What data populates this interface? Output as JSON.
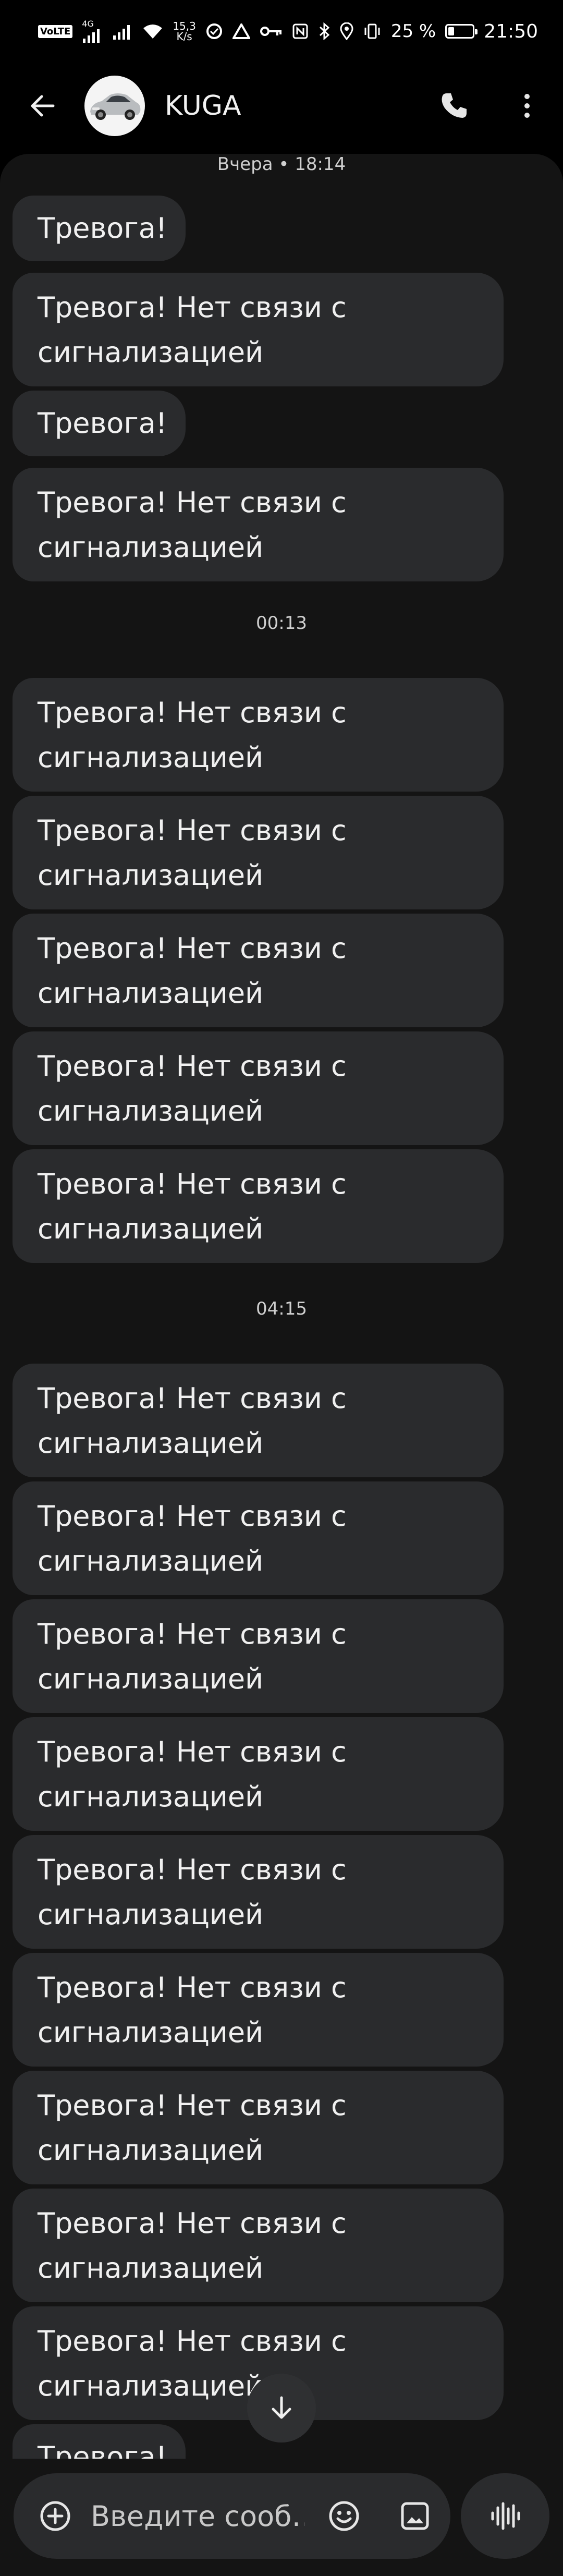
{
  "status_bar": {
    "network_badge": "VoLTE",
    "network_gen": "4G",
    "speed_value": "15,3",
    "speed_unit": "K/s",
    "battery_text": "25 %",
    "battery_level": 0.25,
    "time": "21:50",
    "icons": [
      "volte-icon",
      "signal-icon",
      "signal-icon",
      "wifi-icon",
      "data-saver-icon",
      "mobile-data-icon",
      "vpn-key-icon",
      "nfc-icon",
      "bluetooth-icon",
      "location-icon",
      "vibrate-icon",
      "battery-icon"
    ]
  },
  "header": {
    "contact_name": "KUGA",
    "icons": [
      "back-arrow-icon",
      "car-avatar",
      "phone-icon",
      "more-vert-icon"
    ]
  },
  "conversation": {
    "groups": [
      {
        "time": "Вчера • 18:14",
        "messages": [
          "Тревога!",
          "Тревога! Нет связи с\nсигнализацией",
          "Тревога!",
          "Тревога! Нет связи с\nсигнализацией"
        ]
      },
      {
        "time": "00:13",
        "messages": [
          "Тревога! Нет связи с\nсигнализацией",
          "Тревога! Нет связи с\nсигнализацией",
          "Тревога! Нет связи с\nсигнализацией",
          "Тревога! Нет связи с\nсигнализацией",
          "Тревога! Нет связи с\nсигнализацией"
        ]
      },
      {
        "time": "04:15",
        "messages": [
          "Тревога! Нет связи с\nсигнализацией",
          "Тревога! Нет связи с\nсигнализацией",
          "Тревога! Нет связи с\nсигнализацией",
          "Тревога! Нет связи с\nсигнализацией",
          "Тревога! Нет связи с\nсигнализацией",
          "Тревога! Нет связи с\nсигнализацией",
          "Тревога! Нет связи с\nсигнализацией",
          "Тревога! Нет связи с\nсигнализацией",
          "Тревога! Нет связи с\nсигнализацией",
          "Тревога!"
        ]
      }
    ]
  },
  "compose": {
    "placeholder": "Введите сооб…",
    "icons": [
      "add-circle-icon",
      "emoji-icon",
      "gallery-icon",
      "voice-wave-icon",
      "arrow-down-icon"
    ]
  },
  "colors": {
    "background": "#000000",
    "panel": "#141414",
    "bubble": "#2a2b2d",
    "text": "#f0f0f0"
  }
}
